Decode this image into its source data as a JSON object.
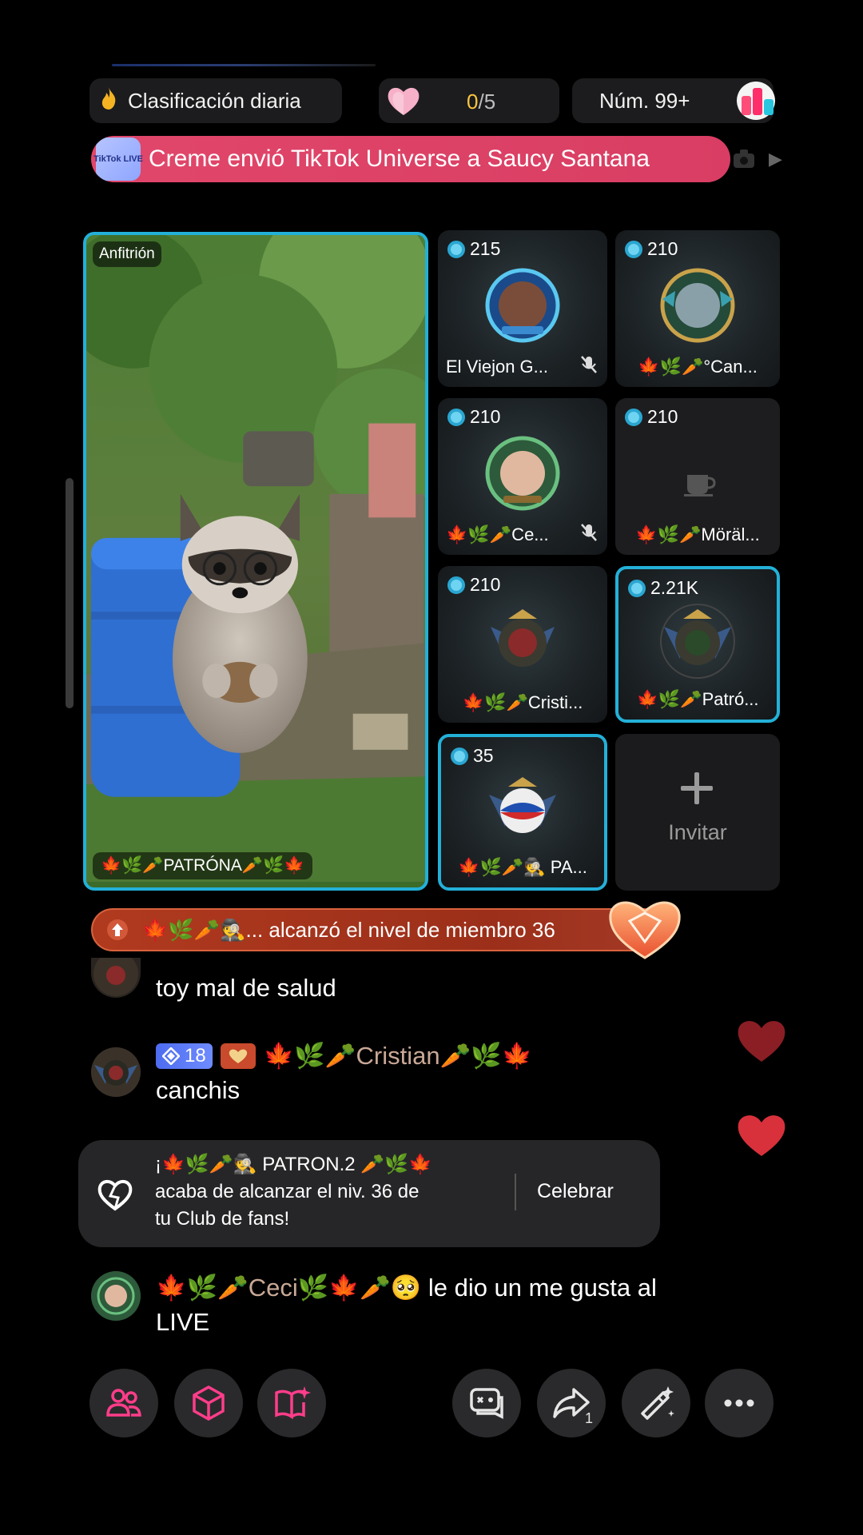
{
  "top_bar": {
    "ranking_label": "Clasificación diaria",
    "goal_done": "0",
    "goal_total": "/5",
    "rank_number": "Núm. 99+"
  },
  "gift_banner": {
    "badge_text": "TikTok LIVE",
    "message": "Creme envió TikTok Universe a Saucy Santana"
  },
  "host": {
    "tag": "Anfitrión",
    "name": "🍁🌿🥕PATRÓNA🥕🌿🍁"
  },
  "guests": [
    {
      "score": "215",
      "name": "El Viejon G...",
      "muted": true
    },
    {
      "score": "210",
      "name": "🍁🌿🥕°Can..."
    },
    {
      "score": "210",
      "name": "🍁🌿🥕Ce...",
      "muted": true
    },
    {
      "score": "210",
      "name": "🍁🌿🥕Möräl..."
    },
    {
      "score": "210",
      "name": "🍁🌿🥕Cristi..."
    },
    {
      "score": "2.21K",
      "name": "🍁🌿🥕Patró..."
    },
    {
      "score": "35",
      "name": "🍁🌿🥕🕵️ PA..."
    }
  ],
  "invite_label": "Invitar",
  "level_banner": "🍁🌿🥕🕵️... alcanzó el nivel de miembro 36",
  "chat": [
    {
      "text": "toy mal de salud"
    },
    {
      "level": "18",
      "name": "🍁🌿🥕Cristian🥕🌿🍁",
      "text": "canchis"
    }
  ],
  "fan_club": {
    "message_line1": "¡🍁🌿🥕🕵️ PATRON.2 🥕🌿🍁",
    "message_line2": "acaba de alcanzar el niv. 36 de",
    "message_line3": "tu Club de fans!",
    "button": "Celebrar"
  },
  "like_event": {
    "name": "🍁🌿🥕Ceci🌿🍁🥕🥺",
    "text": " le dio un me gusta al",
    "text2": "LIVE"
  },
  "share_count": "1",
  "colors": {
    "accent_blue": "#23b0d8",
    "gift_pink": "#e1476a",
    "level_red": "#b03a1e",
    "icon_pink": "#ff3d8a"
  }
}
